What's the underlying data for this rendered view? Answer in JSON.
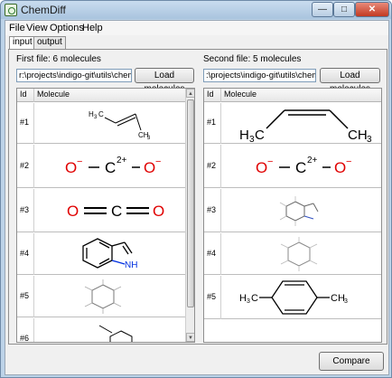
{
  "window": {
    "title": "ChemDiff",
    "buttons": {
      "minimize": "—",
      "maximize": "□",
      "close": "✕"
    }
  },
  "menu": [
    "File",
    "View",
    "Options",
    "Help"
  ],
  "tabs": [
    "input",
    "output"
  ],
  "left": {
    "count_label": "First file: 6 molecules",
    "path": "r:\\projects\\indigo-git\\utils\\chemdiff\\",
    "load_label": "Load molecules",
    "columns": [
      "Id",
      "Molecule"
    ],
    "rows": [
      {
        "id": "#1",
        "mol": "but-2-ene"
      },
      {
        "id": "#2",
        "mol": "o-c-o-ions"
      },
      {
        "id": "#3",
        "mol": "co2"
      },
      {
        "id": "#4",
        "mol": "indole"
      },
      {
        "id": "#5",
        "mol": "hexamethylcyclohexane"
      },
      {
        "id": "#6",
        "mol": "toluene-partial"
      }
    ]
  },
  "right": {
    "count_label": "Second file: 5 molecules",
    "path": ":\\projects\\indigo-git\\utils\\chemdiff\\b",
    "load_label": "Load molecules",
    "columns": [
      "Id",
      "Molecule"
    ],
    "rows": [
      {
        "id": "#1",
        "mol": "cis-but-2-ene"
      },
      {
        "id": "#2",
        "mol": "o-c-o-ions"
      },
      {
        "id": "#3",
        "mol": "indole-h"
      },
      {
        "id": "#4",
        "mol": "hexamethylcyclohexane"
      },
      {
        "id": "#5",
        "mol": "p-xylene"
      }
    ]
  },
  "labels": {
    "h3c": "H",
    "ch3": "CH",
    "three": "3",
    "nh": "NH",
    "o": "O",
    "c": "C",
    "charge2": "2+",
    "minus": "−"
  },
  "compare_label": "Compare",
  "colors": {
    "oxygen": "#e00000",
    "nitrogen": "#0030e0",
    "bond": "#000000",
    "faint": "#9a9a9a"
  }
}
